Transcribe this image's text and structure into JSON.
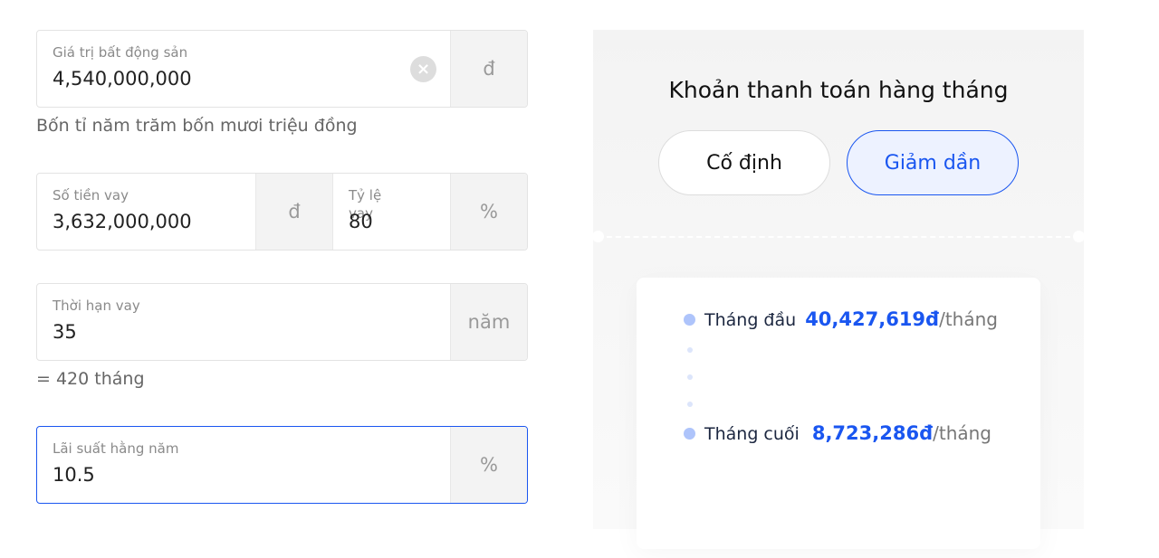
{
  "property": {
    "label": "Giá trị bất động sản",
    "value": "4,540,000,000",
    "unit": "đ",
    "in_words": "Bốn tỉ năm trăm bốn mươi triệu đồng",
    "clear_icon": "close-circle-icon"
  },
  "loan": {
    "label": "Số tiền vay",
    "value": "3,632,000,000",
    "unit": "đ"
  },
  "ratio": {
    "label": "Tỷ lệ vay",
    "value": "80",
    "unit": "%"
  },
  "term": {
    "label": "Thời hạn vay",
    "value": "35",
    "unit": "năm",
    "months_text": "= 420 tháng"
  },
  "rate": {
    "label": "Lãi suất hằng năm",
    "value": "10.5",
    "unit": "%"
  },
  "panel": {
    "title": "Khoản thanh toán hàng tháng",
    "tabs": [
      {
        "label": "Cố định",
        "active": false
      },
      {
        "label": "Giảm dần",
        "active": true
      }
    ],
    "first": {
      "label": "Tháng đầu",
      "amount": "40,427,619đ",
      "per": "/tháng"
    },
    "last": {
      "label": "Tháng cuối",
      "amount": "8,723,286đ",
      "per": "/tháng"
    }
  },
  "colors": {
    "accent": "#1a56f0"
  }
}
